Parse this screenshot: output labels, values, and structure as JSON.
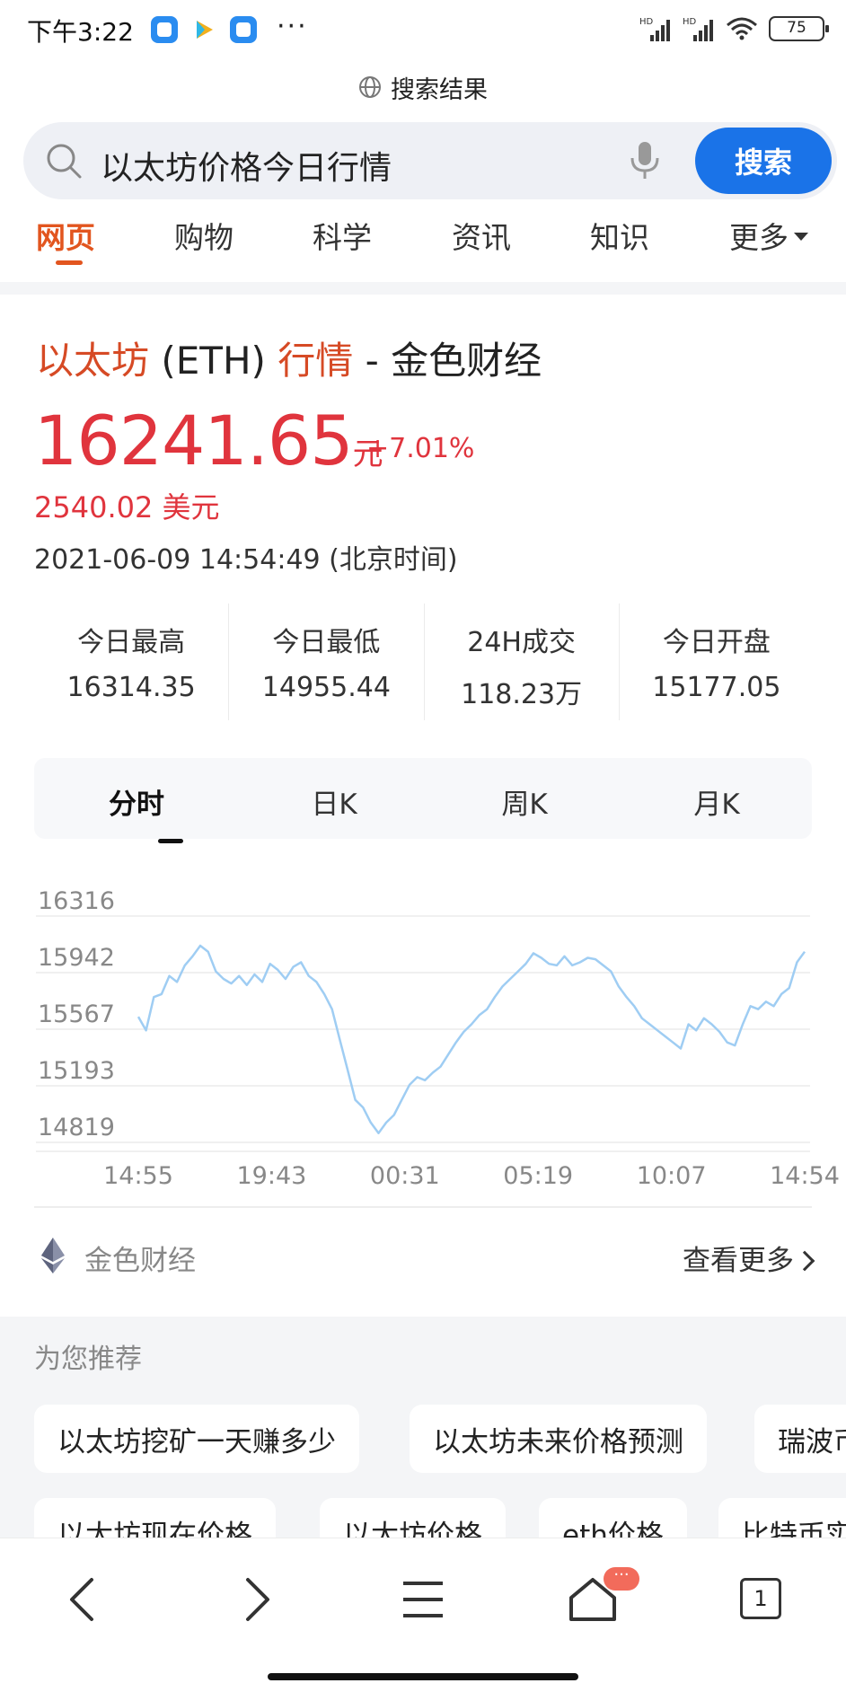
{
  "status_bar": {
    "time": "下午3:22",
    "more": "···",
    "battery": "75"
  },
  "header": {
    "title": "搜索结果",
    "search_query": "以太坊价格今日行情",
    "search_button": "搜索"
  },
  "tabs": [
    {
      "label": "网页",
      "active": true
    },
    {
      "label": "购物",
      "active": false
    },
    {
      "label": "科学",
      "active": false
    },
    {
      "label": "资讯",
      "active": false
    },
    {
      "label": "知识",
      "active": false
    },
    {
      "label": "更多",
      "active": false
    }
  ],
  "card": {
    "title_part1": "以太坊",
    "title_part2": " (ETH) ",
    "title_part3": "行情",
    "title_part4": " - 金色财经",
    "price": "16241.65",
    "price_unit": "元",
    "change": "+7.01%",
    "usd_price": "2540.02 美元",
    "timestamp": "2021-06-09 14:54:49 (北京时间)",
    "stats": [
      {
        "label": "今日最高",
        "value": "16314.35"
      },
      {
        "label": "今日最低",
        "value": "14955.44"
      },
      {
        "label": "24H成交",
        "value": "118.23万"
      },
      {
        "label": "今日开盘",
        "value": "15177.05"
      }
    ],
    "chart_tabs": [
      {
        "label": "分时",
        "active": true
      },
      {
        "label": "日K",
        "active": false
      },
      {
        "label": "周K",
        "active": false
      },
      {
        "label": "月K",
        "active": false
      }
    ],
    "source": "金色财经",
    "see_more": "查看更多"
  },
  "chart_data": {
    "type": "line",
    "title": "",
    "xlabel": "",
    "ylabel": "",
    "y_ticks": [
      "16316",
      "15942",
      "15567",
      "15193",
      "14819"
    ],
    "x_ticks": [
      "14:55",
      "19:43",
      "00:31",
      "05:19",
      "10:07",
      "14:54"
    ],
    "ylim": [
      14819,
      16316
    ],
    "line_color": "#9fcdf3",
    "grid": true,
    "series": [
      {
        "values": [
          15650,
          15560,
          15780,
          15800,
          15920,
          15880,
          15990,
          16050,
          16120,
          16080,
          15950,
          15900,
          15870,
          15920,
          15860,
          15930,
          15880,
          16000,
          15960,
          15900,
          15980,
          16010,
          15920,
          15880,
          15800,
          15700,
          15500,
          15300,
          15100,
          15050,
          14950,
          14880,
          14950,
          15000,
          15100,
          15200,
          15250,
          15230,
          15280,
          15320,
          15400,
          15480,
          15550,
          15600,
          15660,
          15700,
          15780,
          15850,
          15900,
          15950,
          16000,
          16070,
          16040,
          16000,
          15990,
          16050,
          15990,
          16010,
          16040,
          16030,
          15990,
          15950,
          15850,
          15780,
          15720,
          15640,
          15600,
          15560,
          15520,
          15480,
          15440,
          15600,
          15560,
          15640,
          15600,
          15550,
          15480,
          15460,
          15600,
          15720,
          15700,
          15750,
          15720,
          15800,
          15840,
          16010,
          16080
        ]
      }
    ]
  },
  "recommend": {
    "title": "为您推荐",
    "row1": [
      "以太坊挖矿一天赚多少",
      "以太坊未来价格预测",
      "瑞波币"
    ],
    "row2": [
      "以太坊现在价格",
      "以太坊价格",
      "eth价格",
      "比特币实"
    ]
  },
  "bottom_nav": {
    "home_badge": "···",
    "tab_count": "1"
  }
}
